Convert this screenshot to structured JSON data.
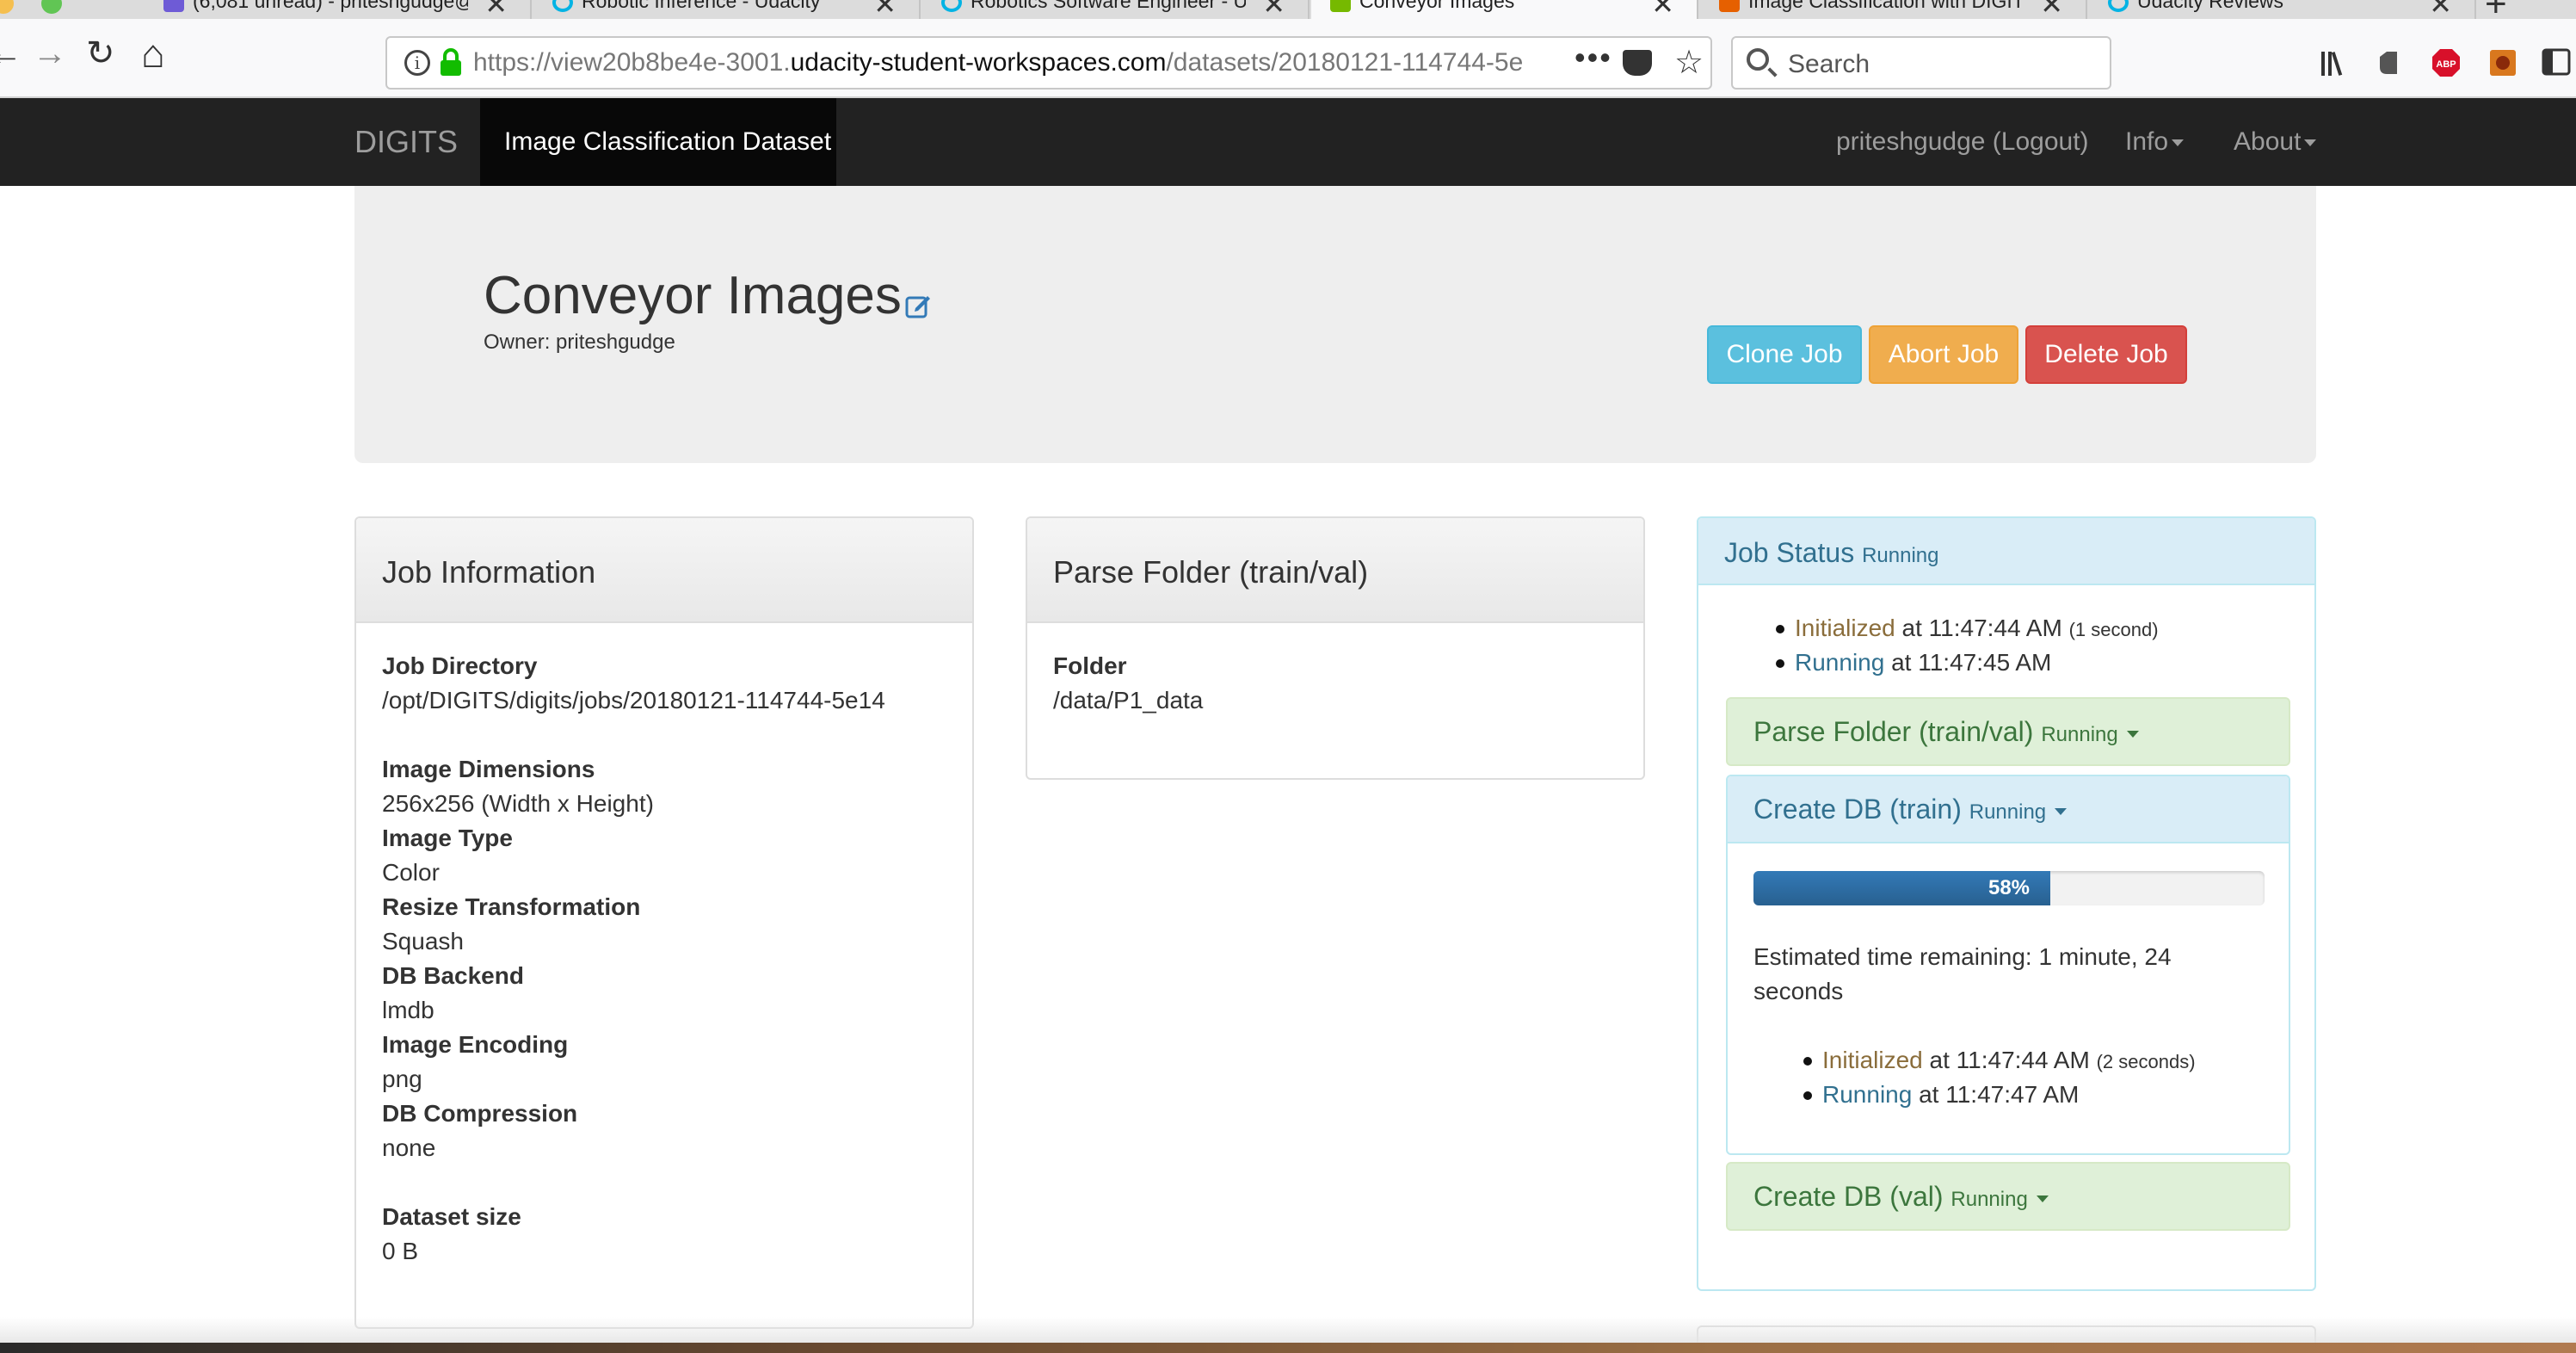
{
  "browser": {
    "tabs": [
      {
        "title": "(6,081 unread) - priteshgudge@",
        "icon_color": "#6e5bd6"
      },
      {
        "title": "Robotic Inference - Udacity",
        "icon_color": "#02b3e4"
      },
      {
        "title": "Robotics Software Engineer - U",
        "icon_color": "#02b3e4"
      },
      {
        "title": "Conveyor Images",
        "icon_color": "#76b900"
      },
      {
        "title": "Image Classification with DIGIT",
        "icon_color": "#e66000"
      },
      {
        "title": "Udacity Reviews",
        "icon_color": "#02b3e4"
      }
    ],
    "url_prefix": "https://view20b8be4e-3001.",
    "url_domain": "udacity-student-workspaces.com",
    "url_path": "/datasets/20180121-114744-5e",
    "search_placeholder": "Search",
    "new_tab": "+",
    "close_glyph": "✕",
    "more_glyph": "•••",
    "star_glyph": "☆",
    "back_glyph": "←",
    "forward_glyph": "→",
    "reload_glyph": "↻",
    "home_glyph": "⌂"
  },
  "app": {
    "brand": "DIGITS",
    "active_nav": "Image Classification Dataset",
    "user_link": "priteshgudge (Logout)",
    "info_menu": "Info",
    "about_menu": "About"
  },
  "header": {
    "title": "Conveyor Images",
    "owner_label": "Owner:",
    "owner": "priteshgudge",
    "clone_button": "Clone Job",
    "abort_button": "Abort Job",
    "delete_button": "Delete Job"
  },
  "job_info": {
    "title": "Job Information",
    "fields": [
      {
        "label": "Job Directory",
        "value": "/opt/DIGITS/digits/jobs/20180121-114744-5e14"
      },
      {
        "label": "Image Dimensions",
        "value": "256x256 (Width x Height)"
      },
      {
        "label": "Image Type",
        "value": "Color"
      },
      {
        "label": "Resize Transformation",
        "value": "Squash"
      },
      {
        "label": "DB Backend",
        "value": "lmdb"
      },
      {
        "label": "Image Encoding",
        "value": "png"
      },
      {
        "label": "DB Compression",
        "value": "none"
      },
      {
        "label": "Dataset size",
        "value": "0 B"
      }
    ]
  },
  "parse_folder": {
    "title": "Parse Folder (train/val)",
    "folder_label": "Folder",
    "folder_value": "/data/P1_data"
  },
  "job_status": {
    "title": "Job Status",
    "status": "Running",
    "events": [
      {
        "state": "Initialized",
        "text": " at 11:47:44 AM ",
        "note": "(1 second)"
      },
      {
        "state": "Running",
        "text": " at 11:47:45 AM",
        "note": ""
      }
    ],
    "tasks": {
      "parse": {
        "title": "Parse Folder (train/val)",
        "status": "Running"
      },
      "train": {
        "title": "Create DB (train)",
        "status": "Running",
        "progress": 0.58,
        "progress_label": "58%",
        "eta_line1": "Estimated time remaining: 1 minute, 24",
        "eta_line2": "seconds",
        "events": [
          {
            "state": "Initialized",
            "text": " at 11:47:44 AM ",
            "note": "(2 seconds)"
          },
          {
            "state": "Running",
            "text": " at 11:47:47 AM",
            "note": ""
          }
        ]
      },
      "val": {
        "title": "Create DB (val)",
        "status": "Running"
      }
    }
  }
}
